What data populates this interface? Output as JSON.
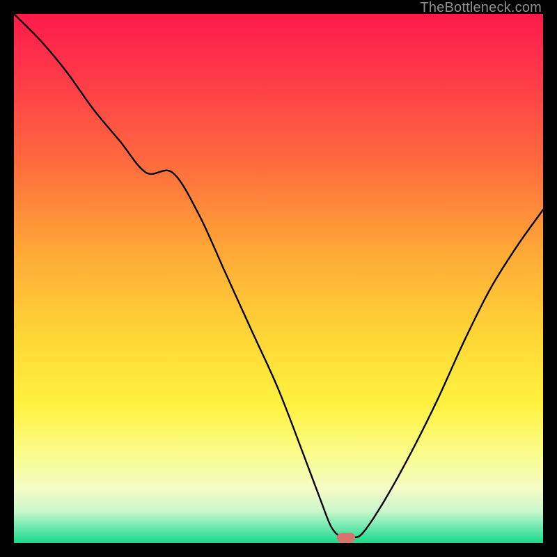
{
  "watermark": "TheBottleneck.com",
  "marker": {
    "x_pct": 62.8,
    "y_pct": 99.0,
    "color": "#d9736e"
  },
  "gradient_stops": [
    {
      "pct": 0,
      "color": "#ff1a4b"
    },
    {
      "pct": 12,
      "color": "#ff3a49"
    },
    {
      "pct": 28,
      "color": "#ff6a3d"
    },
    {
      "pct": 45,
      "color": "#ffa937"
    },
    {
      "pct": 62,
      "color": "#ffd936"
    },
    {
      "pct": 74,
      "color": "#fff240"
    },
    {
      "pct": 83,
      "color": "#fbfc8a"
    },
    {
      "pct": 90,
      "color": "#f3fbc7"
    },
    {
      "pct": 94,
      "color": "#c9f7cc"
    },
    {
      "pct": 97,
      "color": "#6eeab0"
    },
    {
      "pct": 100,
      "color": "#18d88a"
    }
  ],
  "chart_data": {
    "type": "line",
    "title": "",
    "xlabel": "",
    "ylabel": "",
    "xlim": [
      0,
      100
    ],
    "ylim": [
      0,
      100
    ],
    "series": [
      {
        "name": "bottleneck-curve",
        "x": [
          0,
          5,
          10,
          15,
          20,
          25,
          30,
          35,
          40,
          45,
          50,
          55,
          58,
          60,
          62,
          64,
          66,
          70,
          75,
          80,
          85,
          90,
          95,
          100
        ],
        "y": [
          100,
          95,
          89,
          82,
          76,
          70,
          70,
          62,
          51,
          40,
          29,
          16,
          8,
          3,
          1,
          1,
          2,
          8,
          17,
          27,
          38,
          48,
          56,
          63
        ]
      }
    ],
    "marker_point": {
      "x": 62.8,
      "y": 1
    }
  }
}
